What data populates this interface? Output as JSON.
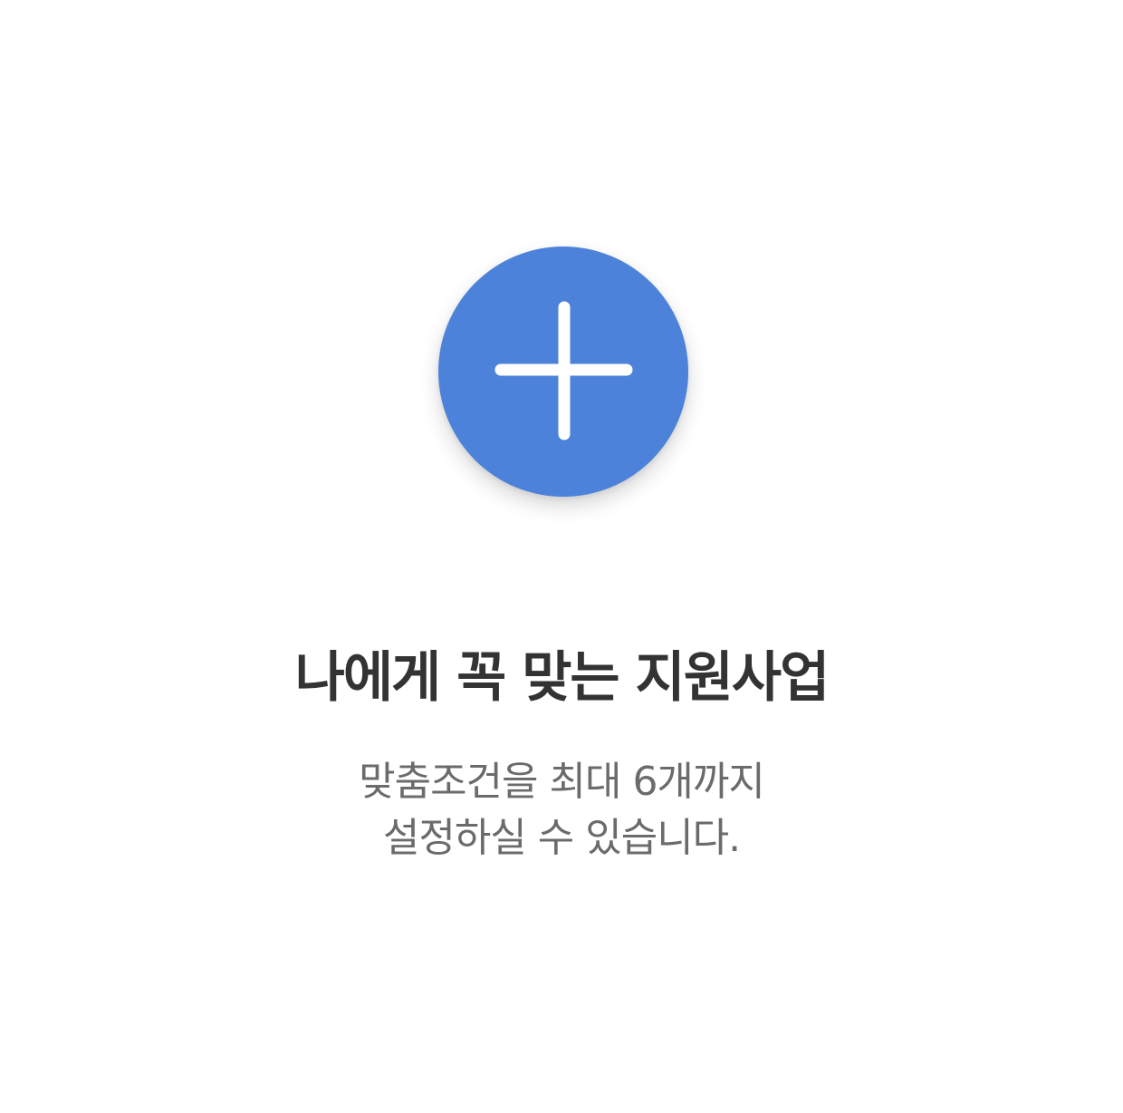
{
  "add_button": {
    "icon": "plus-icon",
    "color": "#4c82d9"
  },
  "title": "나에게 꼭 맞는 지원사업",
  "description": {
    "line1": "맞춤조건을 최대 6개까지",
    "line2": "설정하실 수 있습니다."
  },
  "colors": {
    "background": "#ffffff",
    "title": "#333333",
    "description": "#6b6b6b",
    "icon": "#ffffff"
  }
}
